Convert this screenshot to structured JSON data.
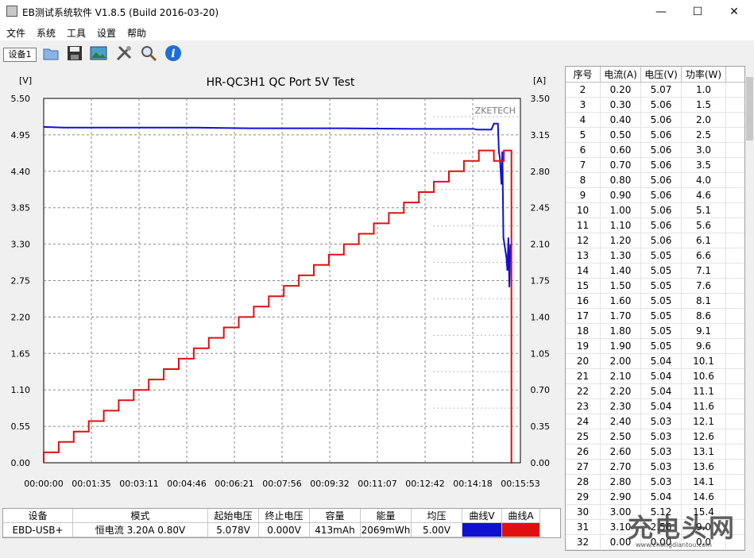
{
  "window": {
    "title": "EB测试系统软件 V1.8.5 (Build 2016-03-20)",
    "minimize": "—",
    "maximize": "☐",
    "close": "✕"
  },
  "menu": [
    "文件",
    "系统",
    "工具",
    "设置",
    "帮助"
  ],
  "toolbar": {
    "device_tab": "设备1",
    "icons": [
      "folder-icon",
      "save-icon",
      "image-icon",
      "tools-icon",
      "search-icon",
      "info-icon"
    ]
  },
  "colors": {
    "voltage": "#1010d0",
    "current": "#e01010"
  },
  "chart_data": {
    "type": "line",
    "title": "HR-QC3H1 QC Port 5V Test",
    "left_unit": "[V]",
    "right_unit": "[A]",
    "brand": "ZKETECH",
    "y_left_ticks": [
      "5.50",
      "4.95",
      "4.40",
      "3.85",
      "3.30",
      "2.75",
      "2.20",
      "1.65",
      "1.10",
      "0.55",
      "0.00"
    ],
    "y_right_ticks": [
      "3.50",
      "3.15",
      "2.80",
      "2.45",
      "2.10",
      "1.75",
      "1.40",
      "1.05",
      "0.70",
      "0.35",
      "0.00"
    ],
    "x_ticks": [
      "00:00:00",
      "00:01:35",
      "00:03:11",
      "00:04:46",
      "00:06:21",
      "00:07:56",
      "00:09:32",
      "00:11:07",
      "00:12:42",
      "00:14:18",
      "00:15:53"
    ],
    "ylim_left": [
      0,
      5.5
    ],
    "ylim_right": [
      0,
      3.5
    ],
    "xlim_seconds": [
      0,
      953
    ],
    "grid": true,
    "series": [
      {
        "axis": "left",
        "x_seconds": [
          0,
          40,
          100,
          300,
          410,
          500,
          600,
          760,
          860,
          866,
          895,
          900,
          905,
          908,
          910,
          912,
          915,
          917,
          919,
          921,
          923,
          925,
          927,
          929,
          931,
          933
        ],
        "y": [
          5.07,
          5.06,
          5.06,
          5.06,
          5.05,
          5.05,
          5.05,
          5.04,
          5.04,
          5.03,
          5.03,
          5.12,
          5.12,
          5.12,
          4.7,
          4.6,
          4.2,
          4.7,
          3.4,
          3.3,
          3.2,
          3.1,
          2.9,
          3.4,
          2.65,
          3.3
        ]
      },
      {
        "axis": "right",
        "step_seconds": 30,
        "start_value": 0.1,
        "step_value": 0.1,
        "steps": 30,
        "tail_x_seconds": [
          900,
          920,
          920,
          935,
          935,
          937
        ],
        "tail_y": [
          2.9,
          2.9,
          3.0,
          3.0,
          0.0,
          0.0
        ]
      }
    ]
  },
  "table": {
    "headers": [
      "序号",
      "电流(A)",
      "电压(V)",
      "功率(W)"
    ],
    "rows": [
      [
        "2",
        "0.20",
        "5.07",
        "1.0"
      ],
      [
        "3",
        "0.30",
        "5.06",
        "1.5"
      ],
      [
        "4",
        "0.40",
        "5.06",
        "2.0"
      ],
      [
        "5",
        "0.50",
        "5.06",
        "2.5"
      ],
      [
        "6",
        "0.60",
        "5.06",
        "3.0"
      ],
      [
        "7",
        "0.70",
        "5.06",
        "3.5"
      ],
      [
        "8",
        "0.80",
        "5.06",
        "4.0"
      ],
      [
        "9",
        "0.90",
        "5.06",
        "4.6"
      ],
      [
        "10",
        "1.00",
        "5.06",
        "5.1"
      ],
      [
        "11",
        "1.10",
        "5.06",
        "5.6"
      ],
      [
        "12",
        "1.20",
        "5.06",
        "6.1"
      ],
      [
        "13",
        "1.30",
        "5.05",
        "6.6"
      ],
      [
        "14",
        "1.40",
        "5.05",
        "7.1"
      ],
      [
        "15",
        "1.50",
        "5.05",
        "7.6"
      ],
      [
        "16",
        "1.60",
        "5.05",
        "8.1"
      ],
      [
        "17",
        "1.70",
        "5.05",
        "8.6"
      ],
      [
        "18",
        "1.80",
        "5.05",
        "9.1"
      ],
      [
        "19",
        "1.90",
        "5.05",
        "9.6"
      ],
      [
        "20",
        "2.00",
        "5.04",
        "10.1"
      ],
      [
        "21",
        "2.10",
        "5.04",
        "10.6"
      ],
      [
        "22",
        "2.20",
        "5.04",
        "11.1"
      ],
      [
        "23",
        "2.30",
        "5.04",
        "11.6"
      ],
      [
        "24",
        "2.40",
        "5.03",
        "12.1"
      ],
      [
        "25",
        "2.50",
        "5.03",
        "12.6"
      ],
      [
        "26",
        "2.60",
        "5.03",
        "13.1"
      ],
      [
        "27",
        "2.70",
        "5.03",
        "13.6"
      ],
      [
        "28",
        "2.80",
        "5.03",
        "14.1"
      ],
      [
        "29",
        "2.90",
        "5.04",
        "14.6"
      ],
      [
        "30",
        "3.00",
        "5.12",
        "15.4"
      ],
      [
        "31",
        "3.10",
        "2.56",
        "9.0"
      ],
      [
        "32",
        "0.00",
        "0.00",
        "0.0"
      ]
    ]
  },
  "summary": {
    "headers": [
      "设备",
      "模式",
      "起始电压",
      "终止电压",
      "容量",
      "能量",
      "均压",
      "曲线V",
      "曲线A"
    ],
    "values": [
      "EBD-USB+",
      "恒电流  3.20A  0.80V",
      "5.078V",
      "0.000V",
      "413mAh",
      "2069mWh",
      "5.00V",
      "",
      ""
    ]
  },
  "watermark": {
    "text": "充电头网",
    "url": "www.chongdiantou.com"
  }
}
